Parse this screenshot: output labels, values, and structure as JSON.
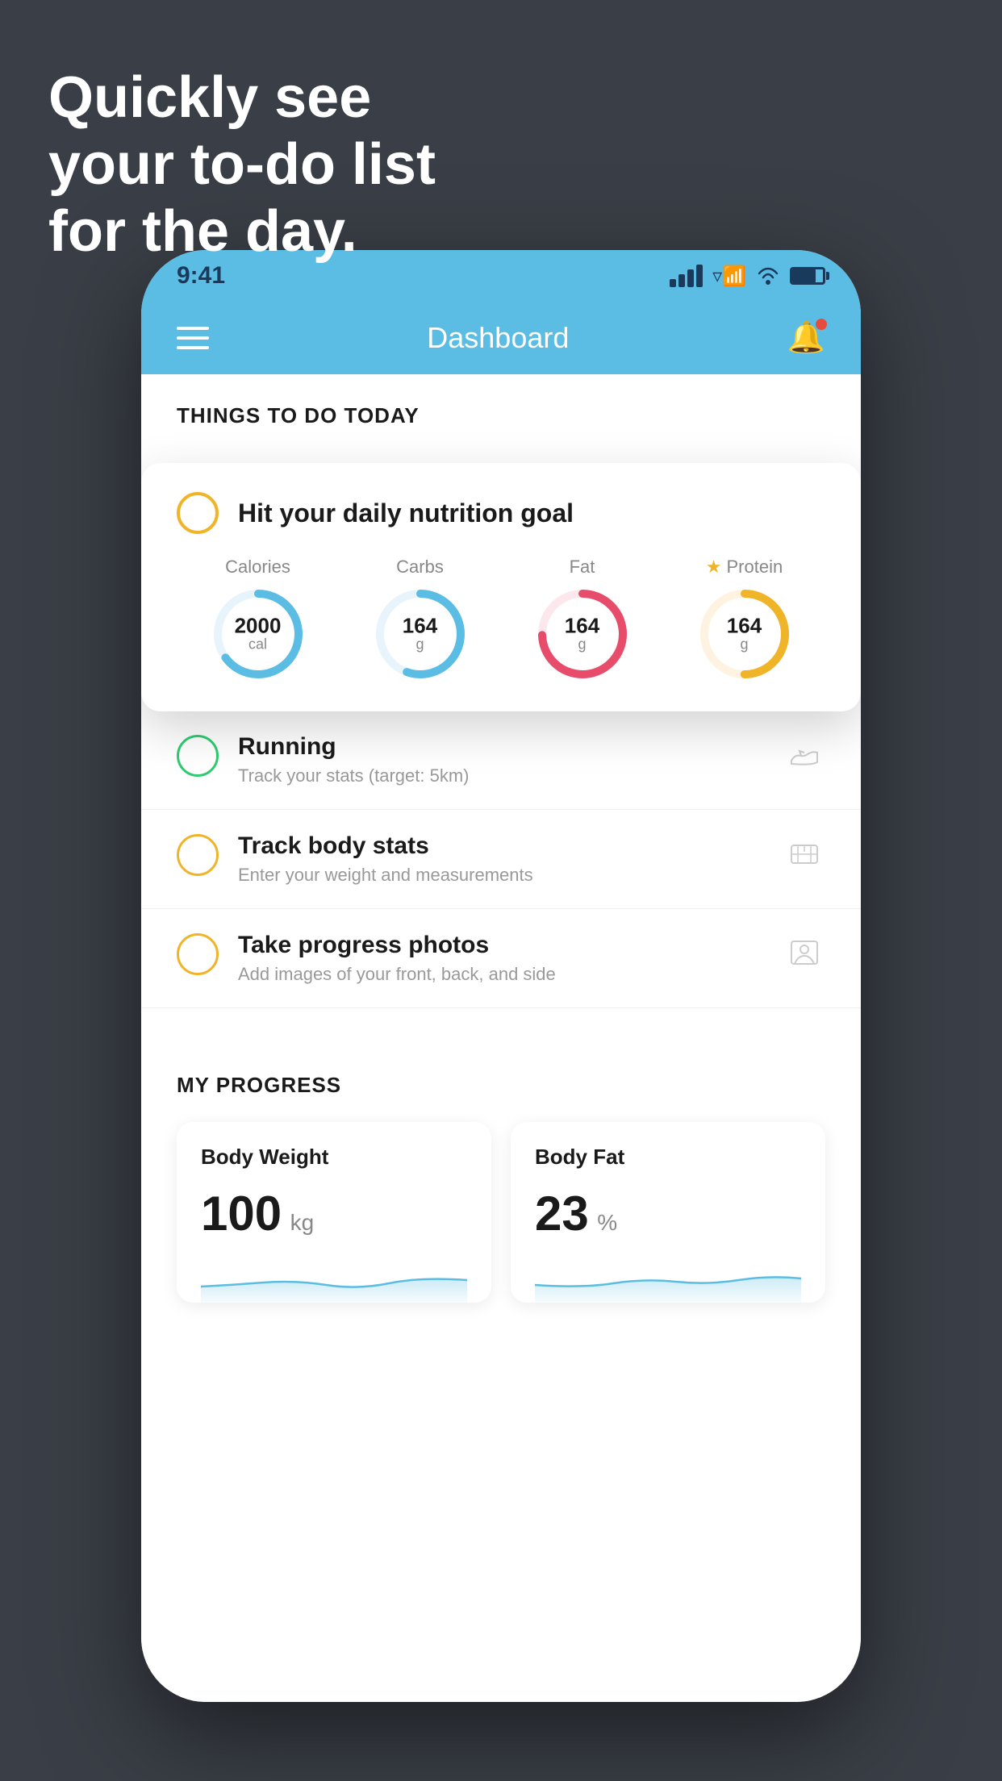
{
  "background_color": "#3a3f47",
  "hero": {
    "line1": "Quickly see",
    "line2": "your to-do list",
    "line3": "for the day."
  },
  "phone": {
    "status_bar": {
      "time": "9:41",
      "signal_bars": 4,
      "battery_percent": 75
    },
    "nav_bar": {
      "title": "Dashboard"
    },
    "things_to_do_header": "THINGS TO DO TODAY",
    "nutrition_card": {
      "circle_color": "yellow",
      "title": "Hit your daily nutrition goal",
      "metrics": [
        {
          "label": "Calories",
          "value": "2000",
          "unit": "cal",
          "color": "#5bbde4",
          "percent": 65,
          "starred": false
        },
        {
          "label": "Carbs",
          "value": "164",
          "unit": "g",
          "color": "#5bbde4",
          "percent": 55,
          "starred": false
        },
        {
          "label": "Fat",
          "value": "164",
          "unit": "g",
          "color": "#e74c6a",
          "percent": 75,
          "starred": false
        },
        {
          "label": "Protein",
          "value": "164",
          "unit": "g",
          "color": "#f0b429",
          "percent": 50,
          "starred": true
        }
      ]
    },
    "todo_items": [
      {
        "circle_color": "green",
        "title": "Running",
        "subtitle": "Track your stats (target: 5km)",
        "icon": "shoe"
      },
      {
        "circle_color": "yellow",
        "title": "Track body stats",
        "subtitle": "Enter your weight and measurements",
        "icon": "scale"
      },
      {
        "circle_color": "yellow",
        "title": "Take progress photos",
        "subtitle": "Add images of your front, back, and side",
        "icon": "person"
      }
    ],
    "progress_section": {
      "header": "MY PROGRESS",
      "cards": [
        {
          "title": "Body Weight",
          "value": "100",
          "unit": "kg"
        },
        {
          "title": "Body Fat",
          "value": "23",
          "unit": "%"
        }
      ]
    }
  }
}
